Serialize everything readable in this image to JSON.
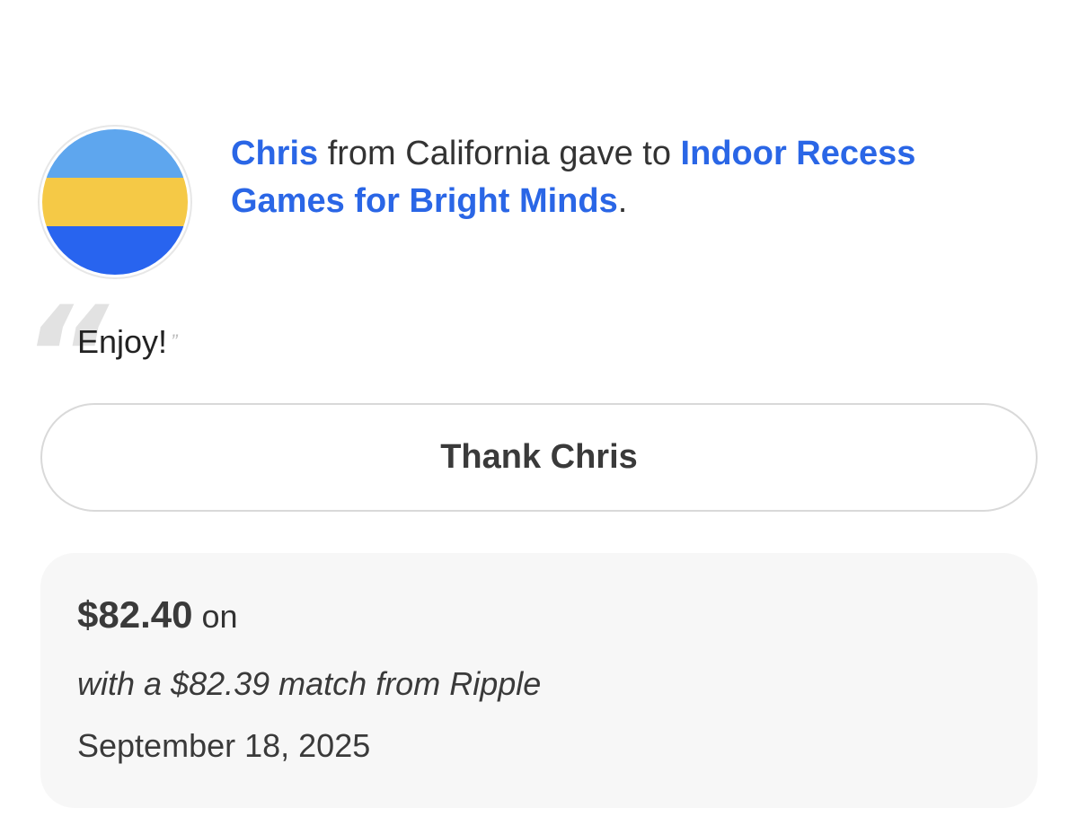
{
  "donor": {
    "name": "Chris",
    "location_text": " from California gave to ",
    "project_title": "Indoor Recess Games for Bright Minds",
    "end_punctuation": "."
  },
  "avatar": {
    "icon": "california-flag-avatar",
    "colors": [
      "#5ea6ee",
      "#f5c946",
      "#2864ef"
    ]
  },
  "message": {
    "text": "Enjoy!",
    "open_quote": "“",
    "close_quote": "”"
  },
  "thank_button": {
    "label": "Thank Chris"
  },
  "summary": {
    "amount": "$82.40",
    "amount_suffix": " on",
    "match_text": "with a $82.39 match from Ripple",
    "date": "September 18, 2025"
  },
  "colors": {
    "link": "#2a66e6",
    "text": "#333333",
    "card_background": "#f7f7f7",
    "button_border": "#d9d9d9"
  }
}
